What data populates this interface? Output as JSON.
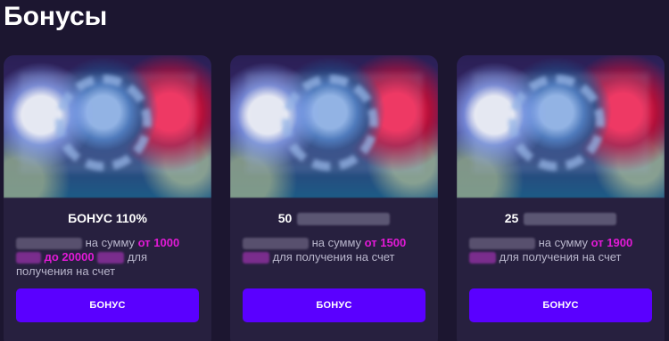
{
  "page": {
    "title": "Бонусы"
  },
  "colors": {
    "background": "#1c1630",
    "card": "#27203f",
    "accent": "#e21ad6",
    "button": "#5a00ff"
  },
  "bonuses": [
    {
      "title": "БОНУС 110%",
      "desc_part1": "на сумму",
      "desc_amount1": "от 1000",
      "desc_amount2": "до 20000",
      "desc_tail": "для получения на счет",
      "button_label": "БОНУС"
    },
    {
      "title": "50",
      "desc_part1": "на сумму",
      "desc_amount1": "от 1500",
      "desc_tail": "для получения на счет",
      "button_label": "БОНУС"
    },
    {
      "title": "25",
      "desc_part1": "на сумму",
      "desc_amount1": "от 1900",
      "desc_tail": "для получения на счет",
      "button_label": "БОНУС"
    }
  ]
}
